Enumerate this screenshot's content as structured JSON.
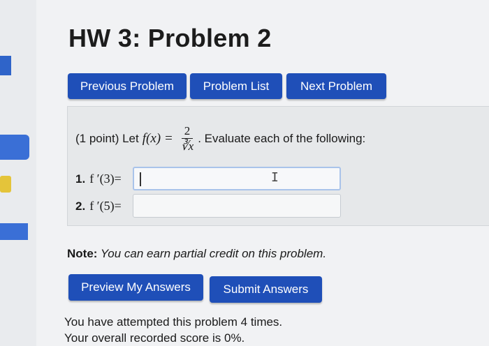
{
  "title": "HW 3: Problem 2",
  "nav": {
    "previous": "Previous Problem",
    "list": "Problem List",
    "next": "Next Problem"
  },
  "problem": {
    "points": "(1 point) Let",
    "func_lhs": "f(x)",
    "equals": "=",
    "numerator": "2",
    "denominator": "∛x",
    "instruction": ". Evaluate each of the following:"
  },
  "questions": [
    {
      "num": "1.",
      "expr": "f ′(3)=",
      "value": ""
    },
    {
      "num": "2.",
      "expr": "f ′(5)=",
      "value": ""
    }
  ],
  "note": {
    "label": "Note:",
    "text": " You can earn partial credit on this problem."
  },
  "actions": {
    "preview": "Preview My Answers",
    "submit": "Submit Answers"
  },
  "status": {
    "attempts": "You have attempted this problem 4 times.",
    "score": "Your overall recorded score is 0%."
  },
  "colors": {
    "button": "#1f4fb8",
    "page_bg": "#f1f2f4",
    "problem_bg": "#e6e8ea"
  }
}
